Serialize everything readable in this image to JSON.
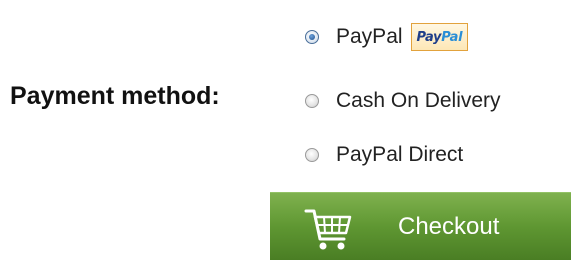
{
  "form": {
    "payment_label": "Payment method:",
    "options": [
      {
        "label": "PayPal",
        "checked": true,
        "logo_text_pay": "Pay",
        "logo_text_pal": "Pal"
      },
      {
        "label": "Cash On Delivery",
        "checked": false
      },
      {
        "label": "PayPal Direct",
        "checked": false
      }
    ],
    "checkout_label": "Checkout"
  },
  "icons": {
    "radio": "radio-button-icon",
    "cart": "shopping-cart-icon"
  },
  "colors": {
    "button_green": "#5f9732",
    "radio_selected": "#1d4f8c",
    "logo_border": "#e2a23c"
  }
}
